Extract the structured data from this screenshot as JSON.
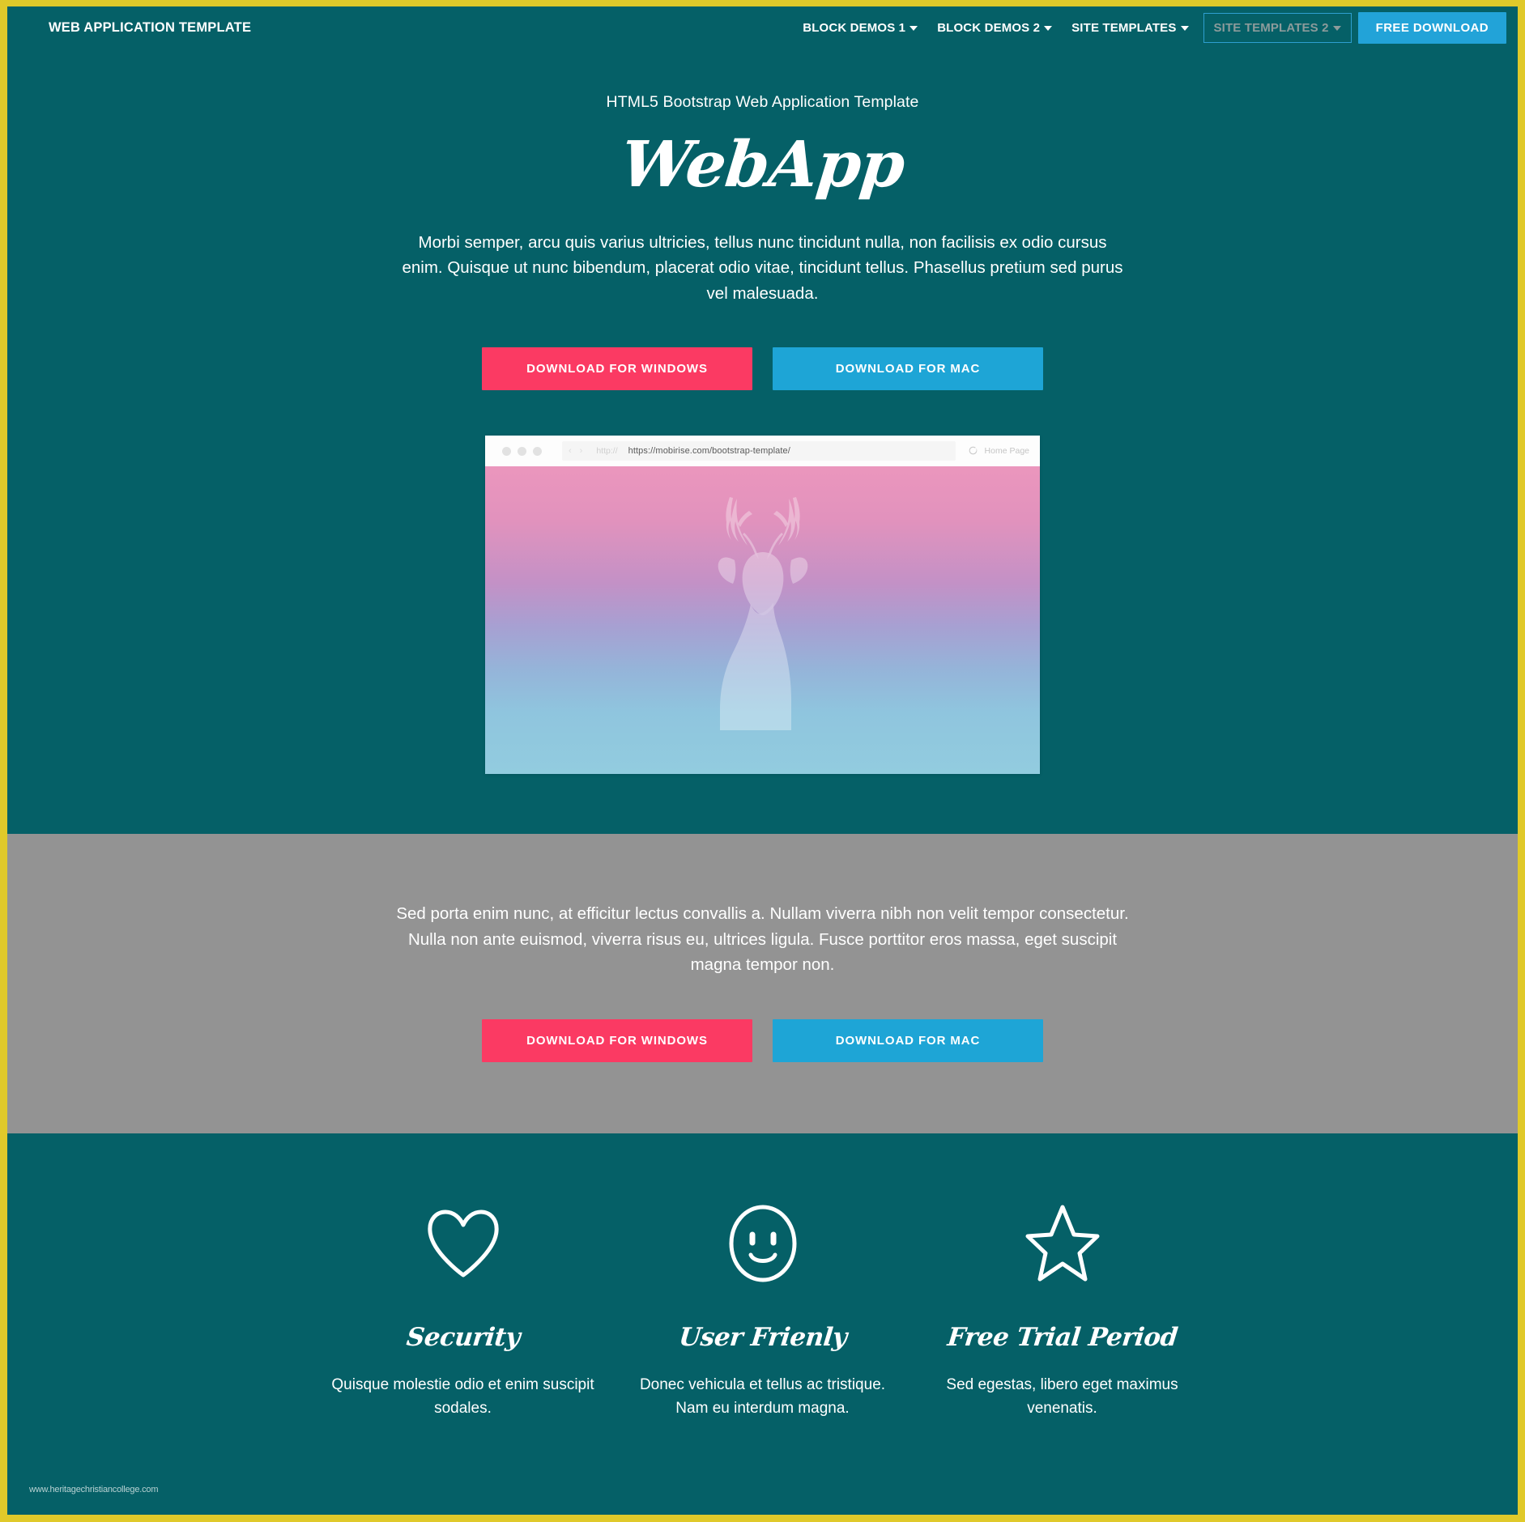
{
  "theme": {
    "frame_color": "#e0c92a",
    "teal": "#056067",
    "gray": "#939393",
    "pink_accent": "#fb3a63",
    "blue_accent": "#1ea5d6",
    "nav_focus_border": "#2e9fd0",
    "text_light": "#ffffff"
  },
  "navbar": {
    "brand": "WEB APPLICATION TEMPLATE",
    "links": [
      {
        "label": "BLOCK DEMOS 1",
        "has_caret": true,
        "state": "normal"
      },
      {
        "label": "BLOCK DEMOS 2",
        "has_caret": true,
        "state": "normal"
      },
      {
        "label": "SITE TEMPLATES",
        "has_caret": true,
        "state": "normal"
      },
      {
        "label": "SITE TEMPLATES 2",
        "has_caret": true,
        "state": "focused"
      }
    ],
    "cta": "FREE DOWNLOAD"
  },
  "hero": {
    "kicker": "HTML5 Bootstrap Web Application Template",
    "title": "WebApp",
    "paragraph": "Morbi semper, arcu quis varius ultricies, tellus nunc tincidunt nulla, non facilisis ex odio cursus enim. Quisque ut nunc bibendum, placerat odio vitae, tincidunt tellus. Phasellus pretium sed purus vel malesuada.",
    "btn_windows": "DOWNLOAD FOR WINDOWS",
    "btn_mac": "DOWNLOAD FOR MAC"
  },
  "browser_mockup": {
    "url_placeholder": "http://",
    "url_value": "https://mobirise.com/bootstrap-template/",
    "back_arrow": "‹",
    "forward_arrow": "›",
    "reload_icon": "reload-icon",
    "home_label": "Home Page",
    "screen_image_alt": "deer-silhouette-gradient"
  },
  "gray_section": {
    "paragraph": "Sed porta enim nunc, at efficitur lectus convallis a. Nullam viverra nibh non velit tempor consectetur. Nulla non ante euismod, viverra risus eu, ultrices ligula. Fusce porttitor eros massa, eget suscipit magna tempor non.",
    "btn_windows": "DOWNLOAD FOR WINDOWS",
    "btn_mac": "DOWNLOAD FOR MAC"
  },
  "features": [
    {
      "icon": "heart-icon",
      "title": "Security",
      "text": "Quisque molestie odio et enim suscipit sodales."
    },
    {
      "icon": "smiley-face-icon",
      "title": "User Frienly",
      "text": "Donec vehicula et tellus ac tristique. Nam eu interdum magna."
    },
    {
      "icon": "star-icon",
      "title": "Free Trial Period",
      "text": "Sed egestas, libero eget maximus venenatis."
    }
  ],
  "watermark": "www.heritagechristiancollege.com"
}
